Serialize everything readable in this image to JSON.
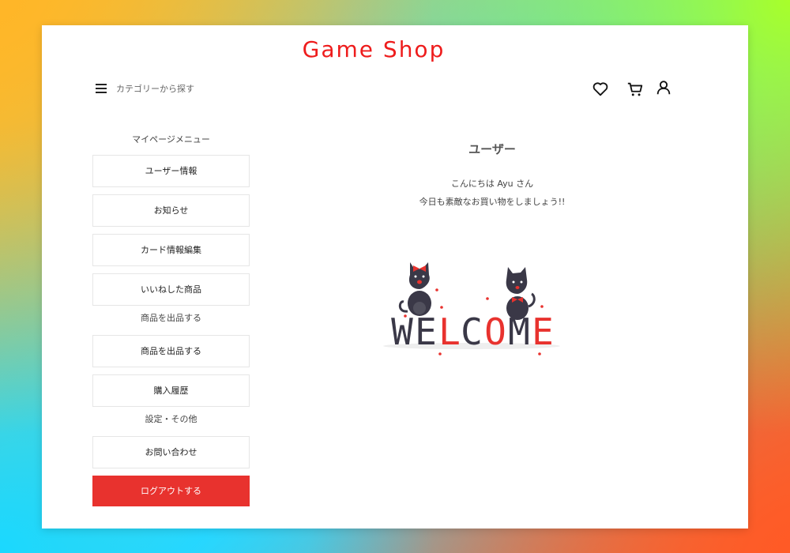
{
  "header": {
    "logo": "Game Shop",
    "category_menu_label": "カテゴリーから探す",
    "icons": [
      "heart-icon",
      "cart-icon",
      "user-icon"
    ]
  },
  "sidebar": {
    "sections": [
      {
        "title": "マイページメニュー",
        "items": [
          "ユーザー情報",
          "お知らせ",
          "カード情報編集",
          "いいねした商品"
        ]
      },
      {
        "title": "商品を出品する",
        "items": [
          "商品を出品する",
          "購入履歴"
        ]
      },
      {
        "title": "設定・その他",
        "items": [
          "お問い合わせ"
        ]
      }
    ],
    "logout_label": "ログアウトする"
  },
  "main": {
    "title": "ユーザー",
    "greeting": "こんにちは Ayu さん",
    "message": "今日も素敵なお買い物をしましょう!!",
    "welcome_text": "WELCOME"
  },
  "colors": {
    "brand": "#ee1c1c",
    "logout": "#e8322e",
    "cat": "#3a3847"
  }
}
